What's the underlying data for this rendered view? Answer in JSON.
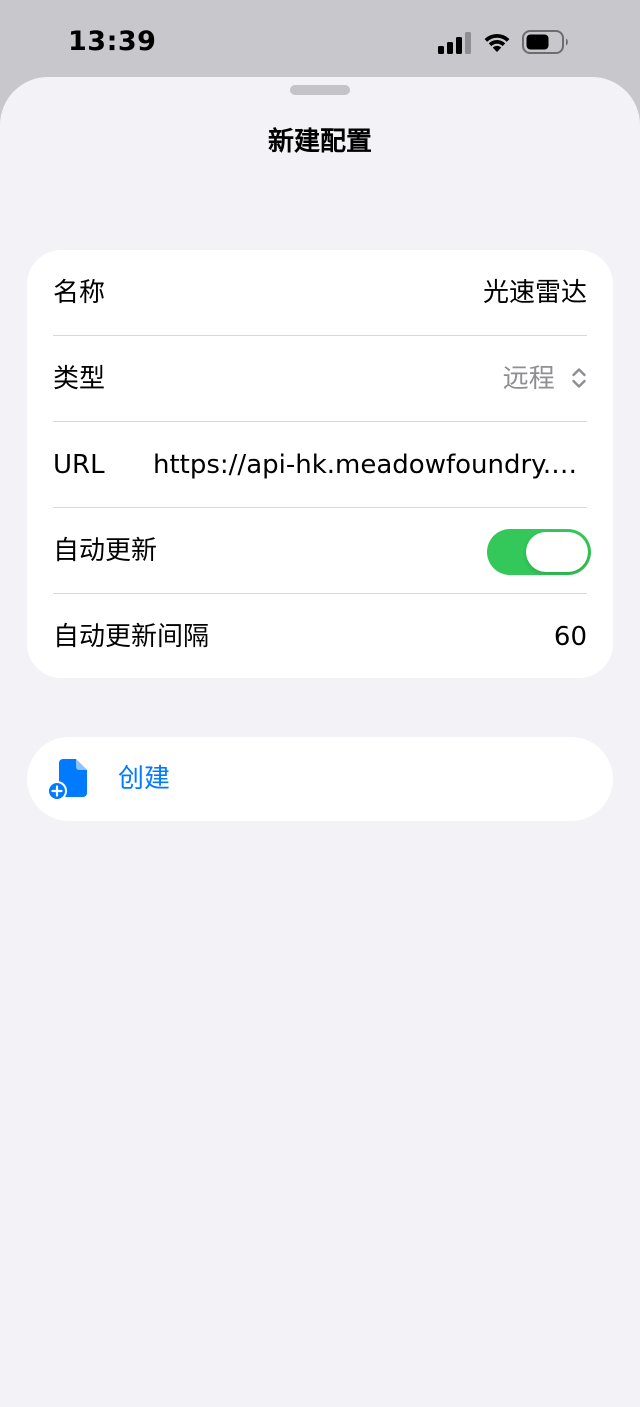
{
  "status_bar": {
    "time": "13:39"
  },
  "sheet": {
    "title": "新建配置"
  },
  "form": {
    "rows": [
      {
        "label": "名称",
        "value": "光速雷达"
      },
      {
        "label": "类型",
        "value": "远程"
      },
      {
        "label": "URL",
        "value": "https://api-hk.meadowfoundry.co..."
      },
      {
        "label": "自动更新",
        "toggle_on": true
      },
      {
        "label": "自动更新间隔",
        "value": "60"
      }
    ]
  },
  "actions": {
    "create_label": "创建"
  },
  "colors": {
    "accent": "#007aff",
    "toggle_on": "#34c759",
    "sheet_background": "#f2f2f7",
    "card_background": "#ffffff",
    "secondary_text": "#8e8e93"
  },
  "icons": {
    "signal": "cellular-signal-icon",
    "wifi": "wifi-icon",
    "battery": "battery-icon",
    "chevron": "chevron-up-down-icon",
    "create": "document-add-icon"
  }
}
